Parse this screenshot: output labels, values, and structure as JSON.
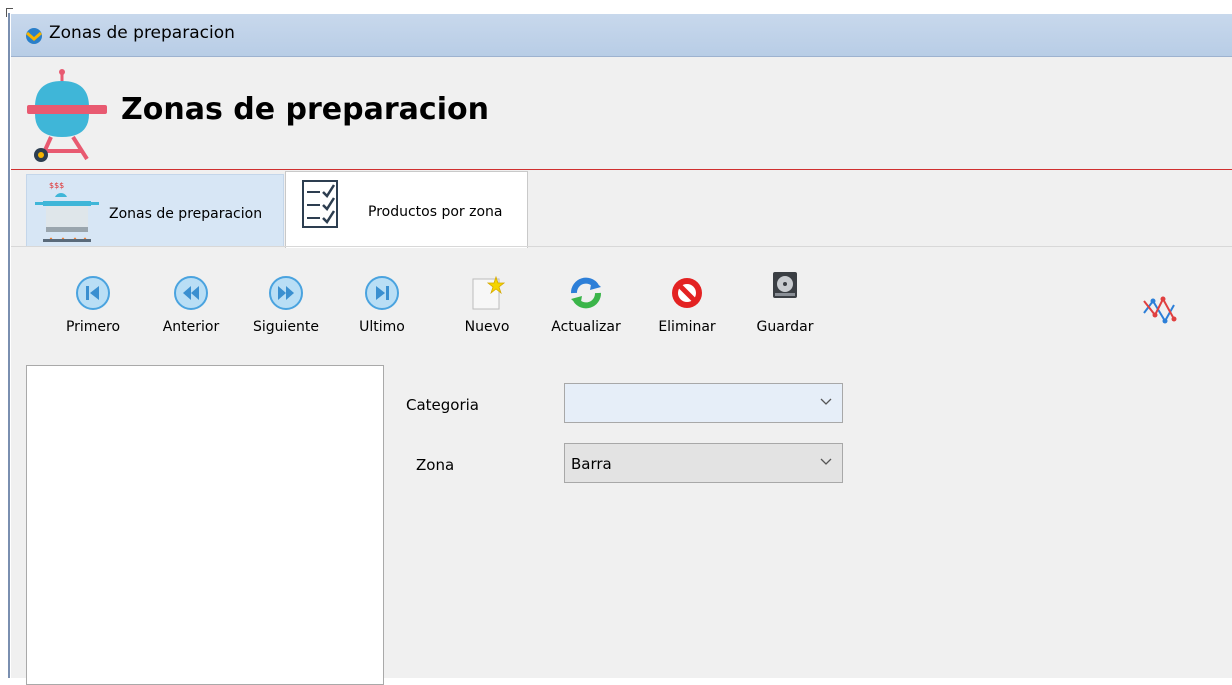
{
  "window": {
    "title": "Zonas de preparacion"
  },
  "header": {
    "title": "Zonas de preparacion",
    "icon": "grill-icon"
  },
  "tabs": [
    {
      "label": "Zonas de preparacion",
      "icon": "cooking-pot-icon",
      "selected": false
    },
    {
      "label": "Productos por zona",
      "icon": "checklist-icon",
      "selected": true
    }
  ],
  "toolbar": {
    "items": [
      {
        "label": "Primero",
        "icon": "first-record-icon"
      },
      {
        "label": "Anterior",
        "icon": "previous-record-icon"
      },
      {
        "label": "Siguiente",
        "icon": "next-record-icon"
      },
      {
        "label": "Ultimo",
        "icon": "last-record-icon"
      },
      {
        "label": "Nuevo",
        "icon": "new-document-icon"
      },
      {
        "label": "Actualizar",
        "icon": "refresh-icon"
      },
      {
        "label": "Eliminar",
        "icon": "delete-icon"
      },
      {
        "label": "Guardar",
        "icon": "save-disk-icon"
      }
    ],
    "extra_icon": "chart-line-icon"
  },
  "form": {
    "categoria_label": "Categoria",
    "categoria_value": "",
    "zona_label": "Zona",
    "zona_value": "Barra"
  },
  "colors": {
    "title_bar": "#c8d8ec",
    "header_divider": "#d03030",
    "inactive_tab": "#d7e6f5",
    "nav_button": "#4aa3df"
  }
}
